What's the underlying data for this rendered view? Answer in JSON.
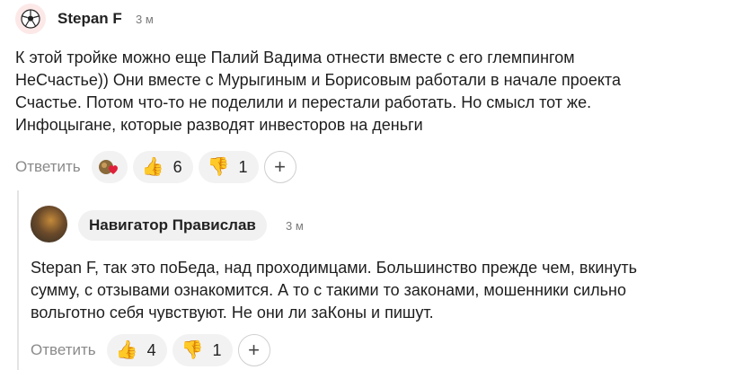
{
  "comments": [
    {
      "author": "Stepan F",
      "time": "3 м",
      "avatar_icon": "soccer-ball",
      "text": "К этой тройке можно еще Палий Вадима отнести вместе с его глемпингом\nНеСчастье)) Они вместе с Мурыгиным и Борисовым работали в начале проекта\nСчастье. Потом что-то не поделили и перестали работать. Но смысл тот же.\nИнфоцыгане, которые разводят инвесторов на деньги",
      "reply_label": "Ответить",
      "reactions": [
        {
          "icon": "heart-reaction-avatar",
          "count": ""
        },
        {
          "icon": "thumbs-up",
          "emoji": "👍",
          "count": "6"
        },
        {
          "icon": "thumbs-down",
          "emoji": "👎",
          "count": "1"
        }
      ],
      "add_reaction": "+"
    },
    {
      "author": "Навигатор Правислав",
      "time": "3 м",
      "avatar_icon": "user-photo",
      "text": "Stepan F, так это поБеда, над проходимцами. Большинство прежде чем, вкинуть\nсумму, с отзывами ознакомится. А то с такими то законами, мошенники сильно\nвольготно себя чувствуют. Не они ли заКоны и пишут.",
      "reply_label": "Ответить",
      "reactions": [
        {
          "icon": "thumbs-up",
          "emoji": "👍",
          "count": "4"
        },
        {
          "icon": "thumbs-down",
          "emoji": "👎",
          "count": "1"
        }
      ],
      "add_reaction": "+"
    }
  ]
}
